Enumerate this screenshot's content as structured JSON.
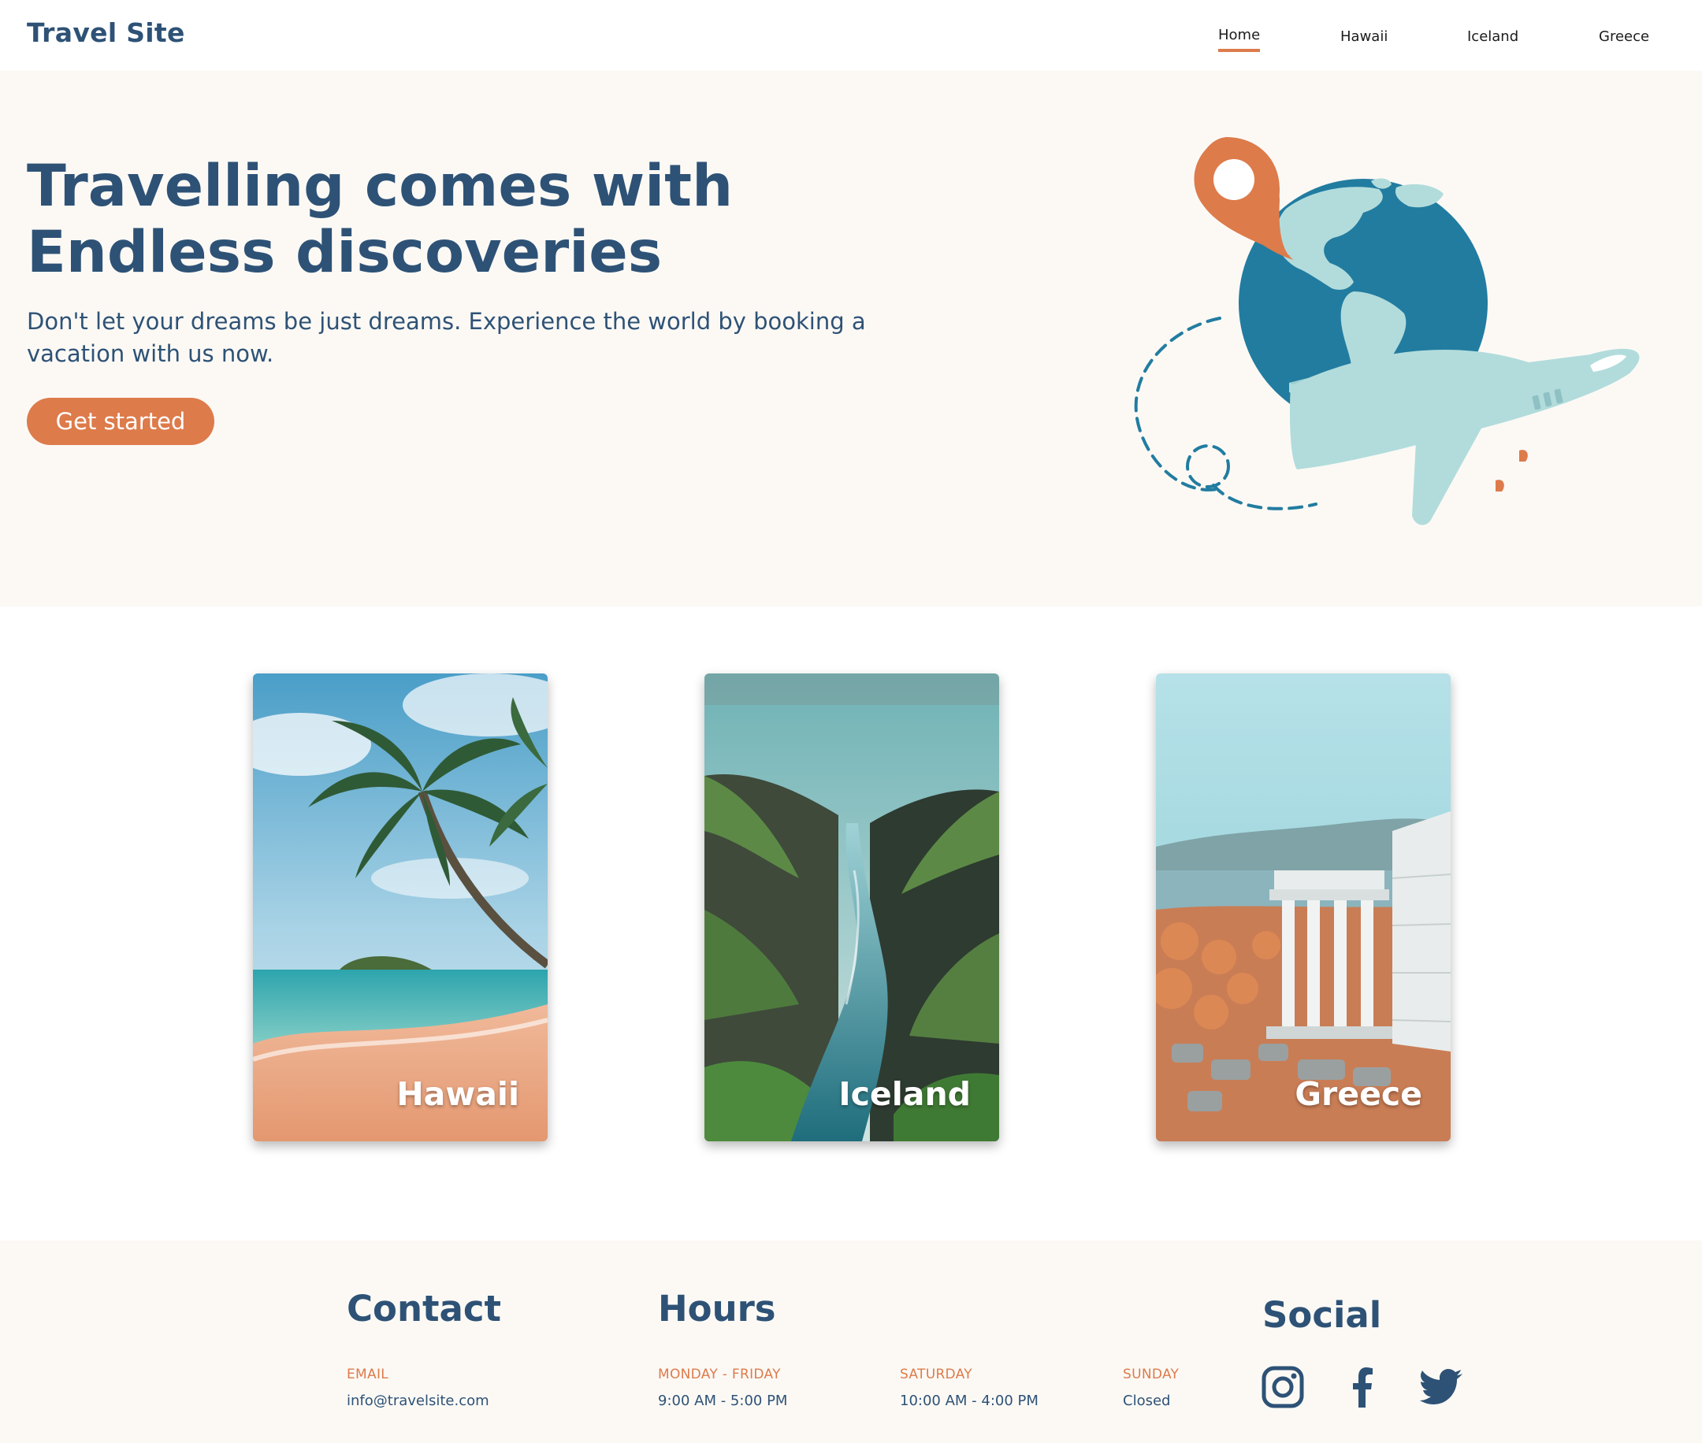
{
  "brand": "Travel Site",
  "nav": {
    "items": [
      {
        "label": "Home",
        "active": true
      },
      {
        "label": "Hawaii",
        "active": false
      },
      {
        "label": "Iceland",
        "active": false
      },
      {
        "label": "Greece",
        "active": false
      }
    ]
  },
  "hero": {
    "title_line1": "Travelling comes with",
    "title_line2": "Endless discoveries",
    "subtitle": "Don't let your dreams be just dreams. Experience the world by booking a vacation with us now.",
    "cta_label": "Get started",
    "illustration_icons": [
      "map-pin-icon",
      "globe-icon",
      "airplane-icon"
    ]
  },
  "destinations": [
    {
      "label": "Hawaii",
      "image": "palm-beach-photo"
    },
    {
      "label": "Iceland",
      "image": "canyon-river-photo"
    },
    {
      "label": "Greece",
      "image": "temple-ruins-photo"
    }
  ],
  "footer": {
    "contact": {
      "heading": "Contact",
      "email_label": "EMAIL",
      "email_value": "info@travelsite.com"
    },
    "hours": {
      "heading": "Hours",
      "weekday_label": "MONDAY - FRIDAY",
      "weekday_value": "9:00 AM - 5:00 PM",
      "saturday_label": "SATURDAY",
      "saturday_value": "10:00 AM - 4:00 PM",
      "sunday_label": "SUNDAY",
      "sunday_value": "Closed"
    },
    "social": {
      "heading": "Social",
      "icons": [
        "instagram-icon",
        "facebook-icon",
        "twitter-icon"
      ]
    }
  },
  "colors": {
    "primary": "#2e5276",
    "accent": "#dd7b4b",
    "hero_bg": "#fcf9f5",
    "globe": "#227ca0",
    "land": "#b2dcdc"
  }
}
